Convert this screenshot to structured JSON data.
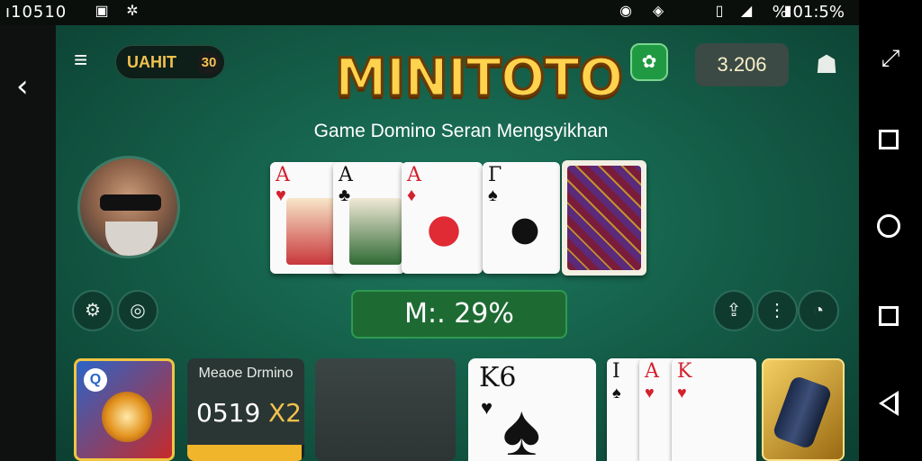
{
  "status_bar": {
    "time": "ı10510",
    "right_text": "% 01:5%",
    "icons": [
      "gallery-icon",
      "bug-icon",
      "alarm-icon",
      "nfc-icon",
      "vibrate-icon",
      "signal-icon",
      "battery-icon"
    ]
  },
  "header": {
    "menu_icon": "menu-icon",
    "back_icon": "chevron-left-icon",
    "chip_label": "UAHIT",
    "chip_badge": "30",
    "logo": "MINITOTO",
    "subtitle": "Game Domino Seran Mengsyikhan",
    "balance": "3.206"
  },
  "table": {
    "cards": [
      {
        "rank": "A",
        "suit": "♥",
        "color": "red"
      },
      {
        "rank": "A",
        "suit": "♣",
        "color": "black"
      },
      {
        "rank": "A",
        "suit": "♦",
        "color": "red"
      },
      {
        "rank": "Γ",
        "suit": "♠",
        "color": "black"
      }
    ],
    "multiplier": "M:. 29%"
  },
  "bottom": {
    "tile_name": "Meaoe Drmino",
    "tile_score": "0519",
    "tile_mult": "X2",
    "tile_progress": 0.98,
    "big_card_rank": "K6",
    "big_card_suit": "♠",
    "small_cards": [
      {
        "rank": "I",
        "suit": "♠",
        "color": "black"
      },
      {
        "rank": "A",
        "suit": "♥",
        "color": "red"
      },
      {
        "rank": "K",
        "suit": "♥",
        "color": "red"
      }
    ]
  },
  "colors": {
    "felt": "#135a45",
    "accent_gold": "#f2c14e",
    "multiplier_green": "#1d6b33"
  }
}
